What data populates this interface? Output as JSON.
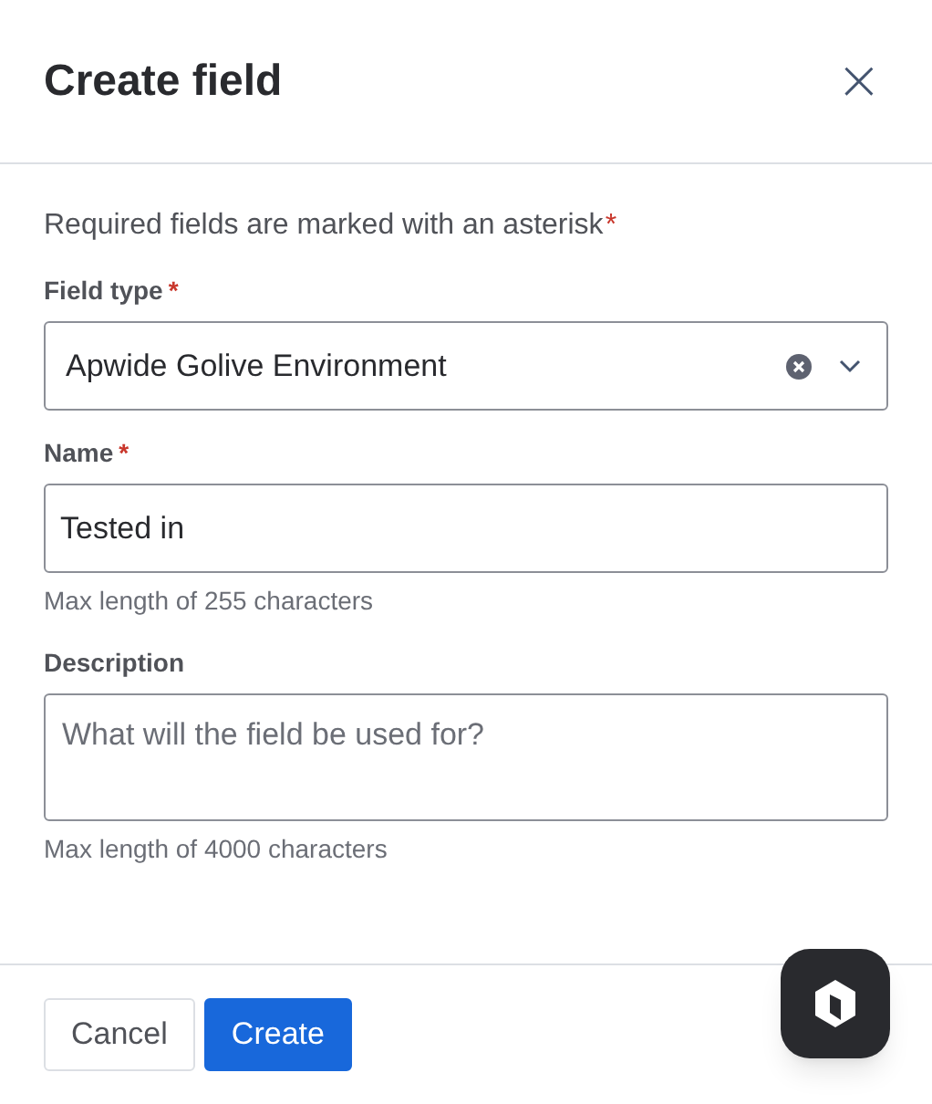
{
  "dialog": {
    "title": "Create field",
    "close": "×"
  },
  "intro": {
    "text": "Required fields are marked with an asterisk",
    "mark": "*"
  },
  "fields": [
    {
      "kind": "select",
      "label": "Field type",
      "required_mark": "*",
      "value": "Apwide Golive Environment"
    },
    {
      "kind": "text",
      "label": "Name",
      "required_mark": "*",
      "value": "Tested in",
      "helper": "Max length of 255 characters"
    },
    {
      "kind": "textarea",
      "label": "Description",
      "placeholder": "What will the field be used for?",
      "helper": "Max length of 4000 characters"
    }
  ],
  "buttons": [
    {
      "label": "Cancel",
      "kind": "secondary"
    },
    {
      "label": "Create",
      "kind": "primary"
    }
  ]
}
